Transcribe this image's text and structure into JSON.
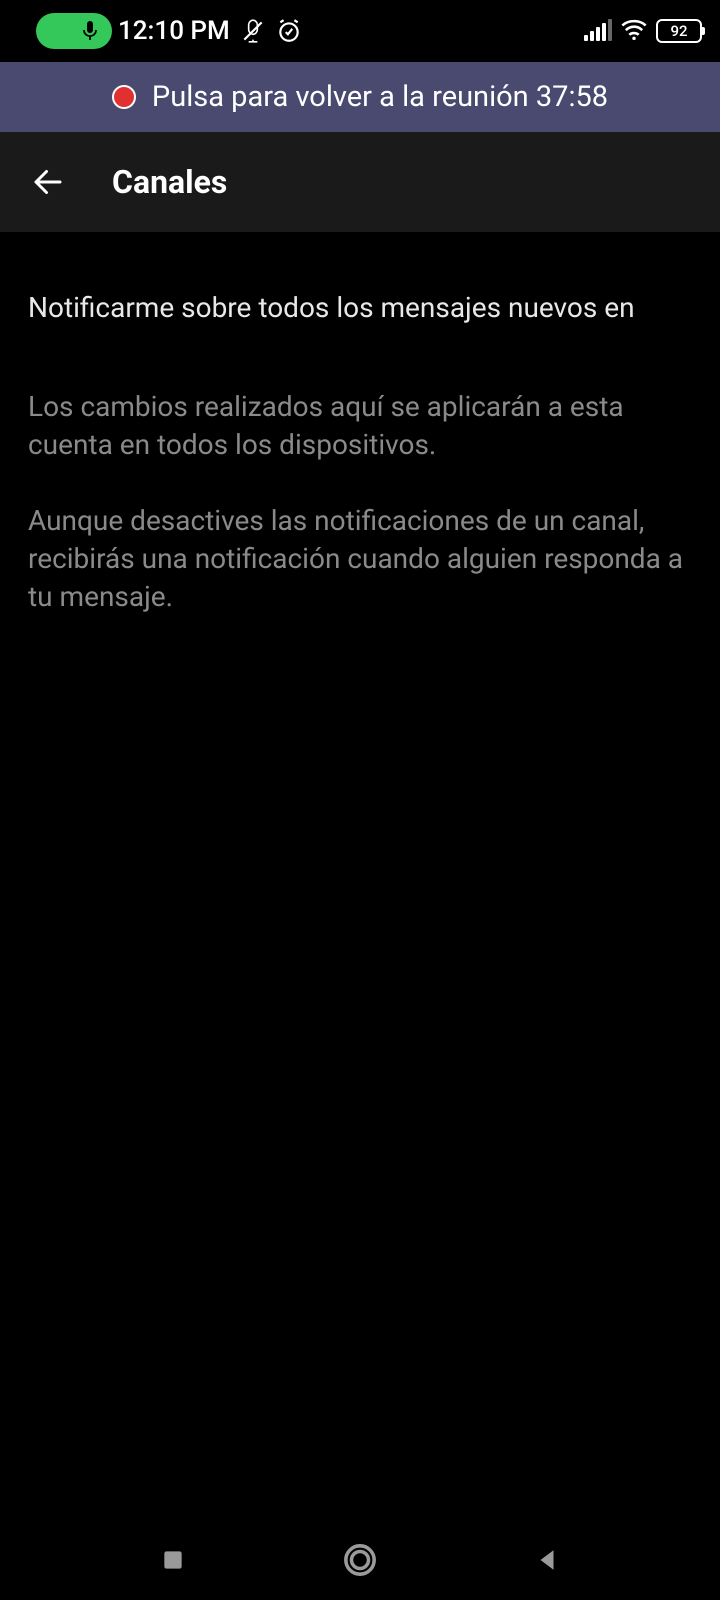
{
  "status_bar": {
    "time": "12:10 PM",
    "battery_level": "92"
  },
  "meeting_banner": {
    "text": "Pulsa para volver a la reunión 37:58"
  },
  "header": {
    "title": "Canales"
  },
  "content": {
    "heading": "Notificarme sobre todos los mensajes nuevos en",
    "description_1": "Los cambios realizados aquí se aplicarán a esta cuenta en todos los dispositivos.",
    "description_2": "Aunque desactives las notificaciones de un canal, recibirás una notificación cuando alguien responda a tu mensaje."
  }
}
